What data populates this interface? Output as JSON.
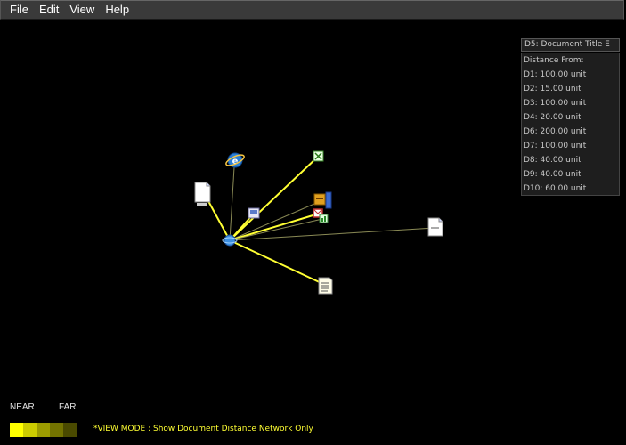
{
  "menu": {
    "file": "File",
    "edit": "Edit",
    "view": "View",
    "help": "Help"
  },
  "info_panel": {
    "title": "D5: Document Title E",
    "heading": "Distance From:",
    "distances": [
      "D1: 100.00 unit",
      "D2: 15.00 unit",
      "D3: 100.00 unit",
      "D4: 20.00 unit",
      "D6: 200.00 unit",
      "D7: 100.00 unit",
      "D8: 40.00 unit",
      "D9: 40.00 unit",
      "D10: 60.00 unit"
    ]
  },
  "legend": {
    "near": "NEAR",
    "far": "FAR",
    "scale_colors": [
      "#ffff00",
      "#cccc00",
      "#9c9c00",
      "#737300",
      "#4a4a00"
    ]
  },
  "view_mode": "*VIEW MODE : Show Document Distance Network Only",
  "colors": {
    "near_edge": "#ffff33",
    "far_edge": "#8a8a55",
    "background": "#000000"
  }
}
